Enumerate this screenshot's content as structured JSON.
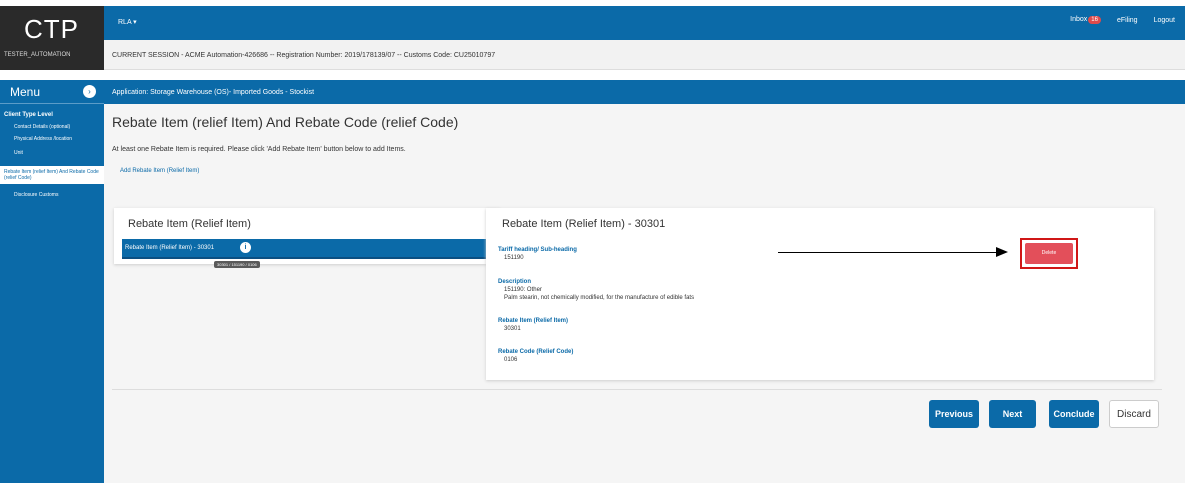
{
  "brand": {
    "logo": "CTP",
    "user": "TESTER_AUTOMATION"
  },
  "topbar": {
    "menu": "RLA ▾",
    "inbox_label": "Inbox",
    "inbox_count": "16",
    "efiling": "eFiling",
    "logout": "Logout"
  },
  "session": {
    "text": "CURRENT SESSION - ACME Automation-426686 -- Registration Number: 2019/178139/07 -- Customs Code: CU25010797"
  },
  "sidebar": {
    "title": "Menu",
    "menu_icon": "chevron-icon",
    "level": "Client Type Level",
    "items": [
      {
        "label": "Contact Details (optional)"
      },
      {
        "label": "Physical Address /location"
      },
      {
        "label": "Unit"
      },
      {
        "label": "Rebate Item (relief Item) And Rebate Code (relief Code)"
      },
      {
        "label": "Disclosure Customs"
      }
    ]
  },
  "appbar": {
    "text": "Application: Storage Warehouse (OS)- Imported Goods - Stockist"
  },
  "main": {
    "heading": "Rebate Item (relief Item) And Rebate Code (relief Code)",
    "info": "At least one Rebate Item is required. Please click 'Add Rebate Item' button below to add Items.",
    "add_link": "Add Rebate Item (Relief Item)"
  },
  "left_panel": {
    "title": "Rebate Item (Relief Item)",
    "item": "Rebate Item (Relief Item) - 30301",
    "tooltip": "30301 / 151190 / 0106"
  },
  "right_panel": {
    "title": "Rebate Item (Relief Item) - 30301",
    "tariff_label": "Tariff heading/ Sub-heading",
    "tariff_value": "151190",
    "desc_label": "Description",
    "desc_line1": "151190: Other",
    "desc_line2": "Palm stearin, not chemically modified, for the manufacture of edible fats",
    "rebate_item_label": "Rebate Item (Relief Item)",
    "rebate_item_value": "30301",
    "rebate_code_label": "Rebate Code (Relief Code)",
    "rebate_code_value": "0106",
    "delete": "Delete"
  },
  "actions": {
    "previous": "Previous",
    "next": "Next",
    "conclude": "Conclude",
    "discard": "Discard"
  },
  "colors": {
    "primary": "#0b6aa8",
    "delete": "#e34f5a",
    "highlight": "#d01717"
  }
}
